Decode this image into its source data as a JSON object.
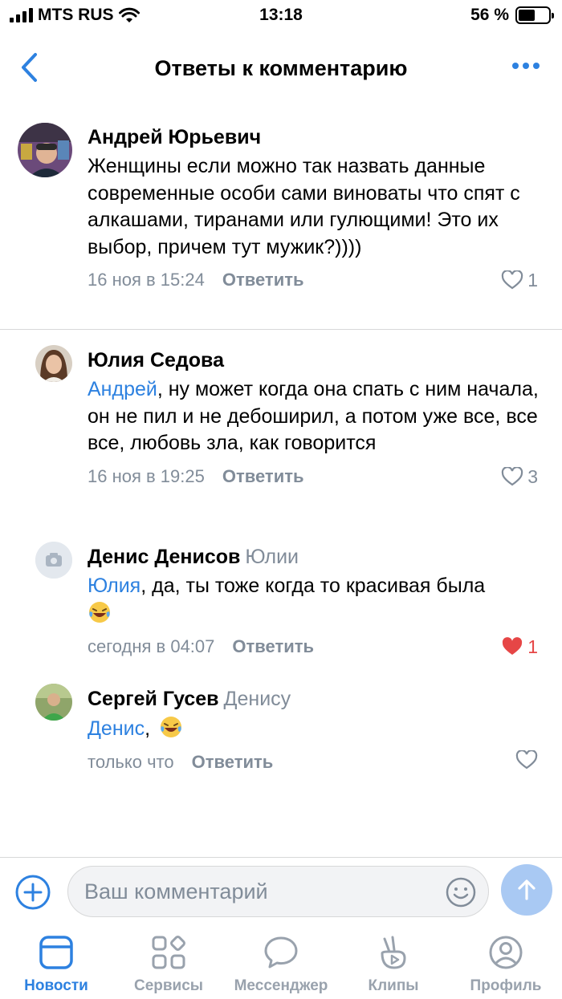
{
  "status_bar": {
    "carrier": "MTS RUS",
    "time": "13:18",
    "battery": "56 %",
    "battery_level": 0.56
  },
  "header": {
    "title": "Ответы к комментарию",
    "back_icon": "chevron-left-icon",
    "more_icon": "more-horizontal-icon"
  },
  "comments": [
    {
      "author": "Андрей Юрьевич",
      "reply_to": "",
      "mention": "",
      "text": "Женщины если можно так назвать данные современные особи сами виноваты что спят с алкашами, тиранами или гулющими! Это их выбор, причем тут мужик?))))",
      "date": "16 ноя в 15:24",
      "reply_label": "Ответить",
      "likes": "1",
      "liked": false
    },
    {
      "author": "Юлия Седова",
      "reply_to": "",
      "mention": "Андрей",
      "text": ", ну может когда она спать с ним начала, он не пил и не дебоширил, а потом уже все, все все, любовь зла, как говорится",
      "date": "16 ноя в 19:25",
      "reply_label": "Ответить",
      "likes": "3",
      "liked": false
    },
    {
      "author": "Денис Денисов",
      "reply_to": "Юлии",
      "mention": "Юлия",
      "text": ", да, ты тоже когда то красивая была",
      "date": "сегодня в 04:07",
      "reply_label": "Ответить",
      "likes": "1",
      "liked": true
    },
    {
      "author": "Сергей Гусев",
      "reply_to": "Денису",
      "mention": "Денис",
      "text": ",",
      "date": "только что",
      "reply_label": "Ответить",
      "likes": "",
      "liked": false
    }
  ],
  "composer": {
    "placeholder": "Ваш комментарий",
    "add_icon": "plus-circle-icon",
    "emoji_icon": "smile-icon",
    "send_icon": "arrow-up-icon"
  },
  "tabbar": [
    {
      "label": "Новости",
      "icon": "news-icon",
      "active": true
    },
    {
      "label": "Сервисы",
      "icon": "services-icon",
      "active": false
    },
    {
      "label": "Мессенджер",
      "icon": "messenger-icon",
      "active": false
    },
    {
      "label": "Клипы",
      "icon": "clips-icon",
      "active": false
    },
    {
      "label": "Профиль",
      "icon": "profile-icon",
      "active": false
    }
  ],
  "colors": {
    "accent": "#2d81e0",
    "secondary_text": "#818c99",
    "like_active": "#e64646",
    "send_disabled": "#a9c9f3"
  }
}
